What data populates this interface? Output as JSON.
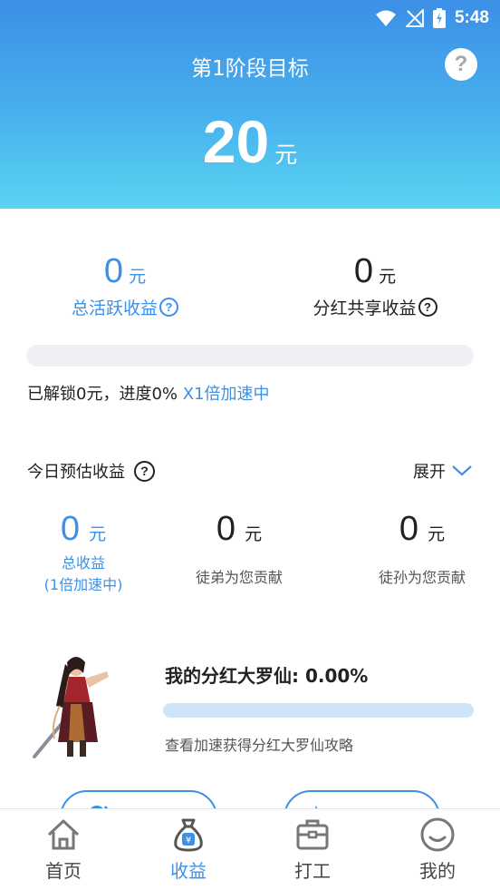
{
  "status_bar": {
    "time": "5:48"
  },
  "header": {
    "title": "第1阶段目标",
    "goal_amount": "20",
    "goal_unit": "元",
    "help_symbol": "?"
  },
  "summary": {
    "active": {
      "value": "0",
      "unit": "元",
      "label": "总活跃收益",
      "help": "?"
    },
    "shared": {
      "value": "0",
      "unit": "元",
      "label": "分红共享收益",
      "help": "?"
    }
  },
  "progress": {
    "fraction": 0,
    "text": "已解锁0元，进度0%",
    "accelerate": "X1倍加速中"
  },
  "today": {
    "title": "今日预估收益",
    "help": "?",
    "expand_label": "展开",
    "columns": [
      {
        "value": "0",
        "unit": "元",
        "label": "总收益",
        "sublabel": "(1倍加速中)"
      },
      {
        "value": "0",
        "unit": "元",
        "label": "徒弟为您贡献"
      },
      {
        "value": "0",
        "unit": "元",
        "label": "徒孙为您贡献"
      }
    ]
  },
  "dividend": {
    "title": "我的分红大罗仙: 0.00%",
    "fraction": 0,
    "link": "查看加速获得分红大罗仙攻略"
  },
  "pills": {
    "left": "团队列表",
    "right": "收益明细"
  },
  "nav": {
    "items": [
      {
        "label": "首页",
        "icon": "home-icon"
      },
      {
        "label": "收益",
        "icon": "money-bag-icon",
        "active": true
      },
      {
        "label": "打工",
        "icon": "briefcase-icon"
      },
      {
        "label": "我的",
        "icon": "smiley-icon"
      }
    ]
  },
  "colors": {
    "accent": "#3c91e6",
    "header_top": "#3c8fe6",
    "header_bottom": "#5ad4f2"
  }
}
